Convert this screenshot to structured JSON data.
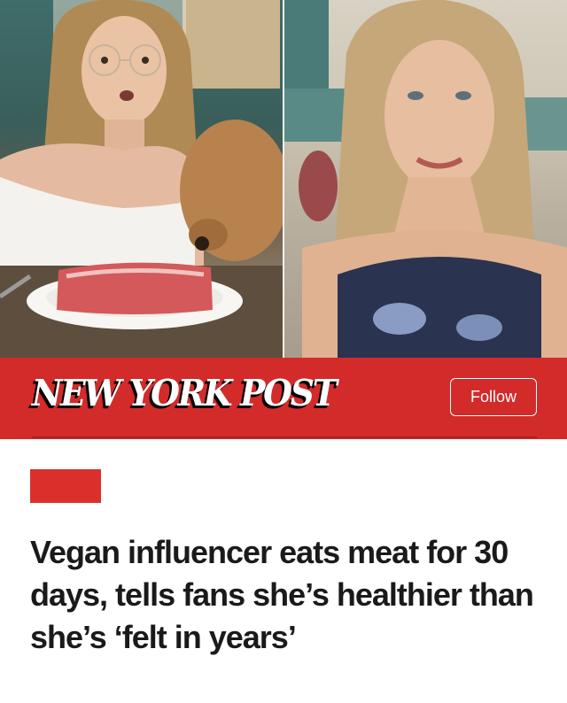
{
  "hero": {
    "left_image": "woman-with-glasses-dog-and-steak-photo",
    "right_image": "smiling-woman-video-still-photo"
  },
  "brand": {
    "logo_text": "NEW YORK POST",
    "follow_label": "Follow",
    "bar_color": "#d32a2a"
  },
  "article": {
    "section_tag_color": "#d9302c",
    "headline": "Vegan influencer eats meat for 30 days, tells fans she’s healthier than she’s ‘felt in years’"
  }
}
